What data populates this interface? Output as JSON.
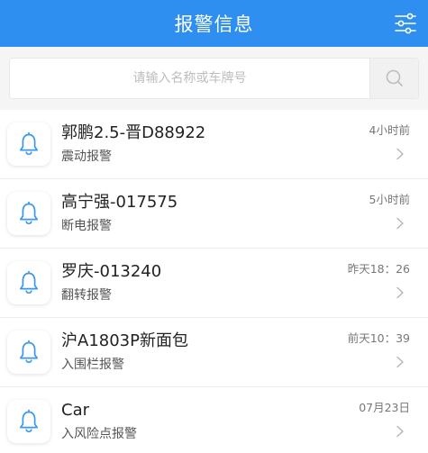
{
  "header": {
    "title": "报警信息",
    "filter_icon": "filter-sliders-icon"
  },
  "search": {
    "placeholder": "请输入名称或车牌号",
    "value": "",
    "button_icon": "search-icon"
  },
  "colors": {
    "accent": "#2f8ff0",
    "bell": "#3a97f0"
  },
  "alarms": [
    {
      "name": "郭鹏2.5-晋D88922",
      "type": "震动报警",
      "time": "4小时前"
    },
    {
      "name": "高宁强-017575",
      "type": "断电报警",
      "time": "5小时前"
    },
    {
      "name": "罗庆-013240",
      "type": "翻转报警",
      "time": "昨天18：26"
    },
    {
      "name": "沪A1803P新面包",
      "type": "入围栏报警",
      "time": "前天10：39"
    },
    {
      "name": "Car",
      "type": "入风险点报警",
      "time": "07月23日"
    }
  ]
}
